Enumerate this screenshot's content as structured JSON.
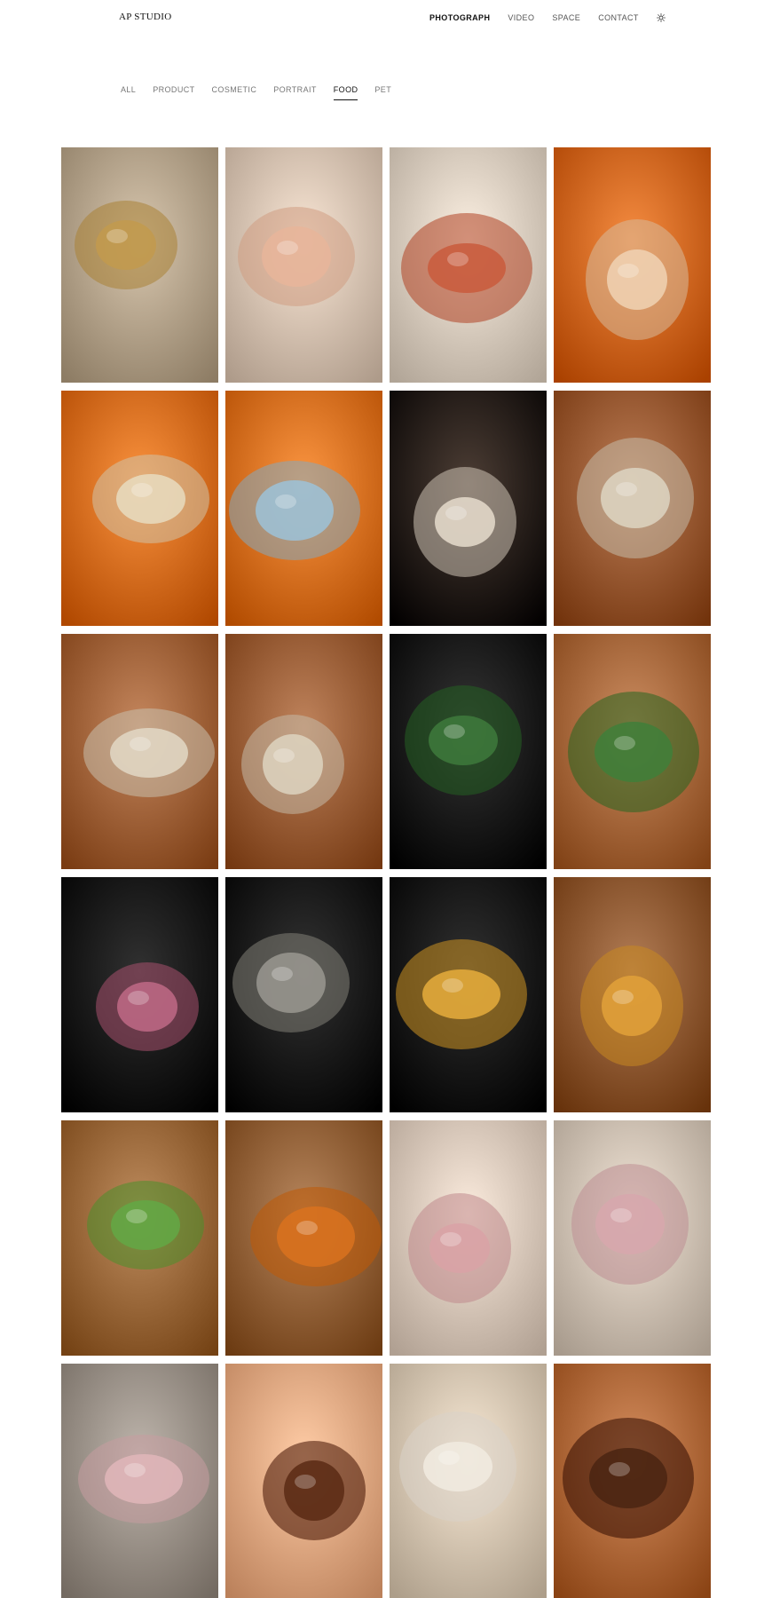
{
  "header": {
    "logo": "AP STUDIO",
    "nav": [
      {
        "label": "PHOTOGRAPH",
        "active": true
      },
      {
        "label": "VIDEO",
        "active": false
      },
      {
        "label": "SPACE",
        "active": false
      },
      {
        "label": "CONTACT",
        "active": false
      }
    ],
    "theme_icon": "sun-icon"
  },
  "filters": [
    {
      "label": "ALL",
      "active": false
    },
    {
      "label": "PRODUCT",
      "active": false
    },
    {
      "label": "COSMETIC",
      "active": false
    },
    {
      "label": "PORTRAIT",
      "active": false
    },
    {
      "label": "FOOD",
      "active": true
    },
    {
      "label": "PET",
      "active": false
    }
  ],
  "gallery": [
    {
      "subject": "risotto-with-fish",
      "bg": "#b5a48c",
      "accent": "#c29a4e"
    },
    {
      "subject": "sliced-raw-fish-salad",
      "bg": "#d6c3b2",
      "accent": "#e8b59a"
    },
    {
      "subject": "flower-dessert",
      "bg": "#d9cdbf",
      "accent": "#c95a3c"
    },
    {
      "subject": "sake-bottle-orange",
      "bg": "#d2691e",
      "accent": "#f0d2b4"
    },
    {
      "subject": "crystal-cocktail-glass",
      "bg": "#d8701c",
      "accent": "#e8dcc0"
    },
    {
      "subject": "sake-bottle-and-cup",
      "bg": "#d9731f",
      "accent": "#9cc2d8"
    },
    {
      "subject": "hands-holding-soup-bowl",
      "bg": "#2a1b12",
      "accent": "#e6dccd"
    },
    {
      "subject": "soup-bowl-on-wood",
      "bg": "#9a5b34",
      "accent": "#ddd5c2"
    },
    {
      "subject": "spoon-with-soup",
      "bg": "#a2643b",
      "accent": "#e2d8c6"
    },
    {
      "subject": "soup-and-side-dishes",
      "bg": "#9c6039",
      "accent": "#ddd3c0"
    },
    {
      "subject": "hot-pot-dark",
      "bg": "#121212",
      "accent": "#3e7a3c"
    },
    {
      "subject": "hot-pot-chives",
      "bg": "#a96a3e",
      "accent": "#3f7f3a"
    },
    {
      "subject": "pink-martini",
      "bg": "#0e0e0e",
      "accent": "#c06a86"
    },
    {
      "subject": "whisky-smoke",
      "bg": "#101010",
      "accent": "#9a9890"
    },
    {
      "subject": "golden-cocktail",
      "bg": "#0e0e0e",
      "accent": "#e6ad3c"
    },
    {
      "subject": "korean-pancake",
      "bg": "#8f5a33",
      "accent": "#e2a13a"
    },
    {
      "subject": "clam-noodle-salad",
      "bg": "#9c6a3c",
      "accent": "#63a845"
    },
    {
      "subject": "clam-noodle-soup",
      "bg": "#94633a",
      "accent": "#d9721f"
    },
    {
      "subject": "sashimi-plate",
      "bg": "#d8c8ba",
      "accent": "#d9a2a6"
    },
    {
      "subject": "sashimi-with-sake",
      "bg": "#cfc2b4",
      "accent": "#d7a7ad"
    },
    {
      "subject": "sashimi-dark-plate",
      "bg": "#9b9289",
      "accent": "#e0b6ba"
    },
    {
      "subject": "liquor-bottle-gifts",
      "bg": "#e3a983",
      "accent": "#5a2a14"
    },
    {
      "subject": "cappuccino-cup",
      "bg": "#d5c6b2",
      "accent": "#f1ebe1"
    },
    {
      "subject": "coffee-bottle-beans",
      "bg": "#b26b3c",
      "accent": "#4a2412"
    }
  ]
}
